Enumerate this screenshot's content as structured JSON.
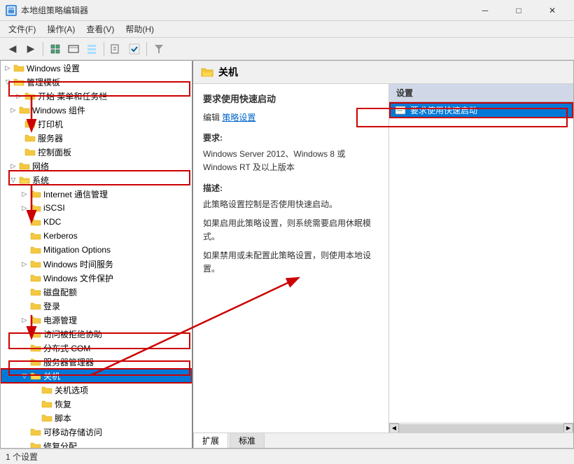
{
  "window": {
    "title": "本地组策略编辑器",
    "minimize": "─",
    "restore": "□",
    "close": "✕"
  },
  "menu": {
    "items": [
      "文件(F)",
      "操作(A)",
      "查看(V)",
      "帮助(H)"
    ]
  },
  "toolbar": {
    "buttons": [
      "◀",
      "▶",
      "⬆",
      "📋",
      "📋",
      "📋",
      "🔍",
      "🔍",
      "▼"
    ]
  },
  "tree": {
    "nodes": [
      {
        "id": "windows-settings",
        "label": "Windows 设置",
        "indent": 0,
        "expanded": false,
        "type": "folder"
      },
      {
        "id": "admin-templates",
        "label": "管理模板",
        "indent": 0,
        "expanded": true,
        "type": "folder-open",
        "highlighted": true
      },
      {
        "id": "start-menu",
        "label": "开始 菜单和任务栏",
        "indent": 2,
        "expanded": false,
        "type": "folder"
      },
      {
        "id": "windows-components",
        "label": "Windows 组件",
        "indent": 1,
        "expanded": false,
        "type": "folder"
      },
      {
        "id": "printers",
        "label": "打印机",
        "indent": 2,
        "expanded": false,
        "type": "folder"
      },
      {
        "id": "servers",
        "label": "服务器",
        "indent": 2,
        "expanded": false,
        "type": "folder"
      },
      {
        "id": "control-panel",
        "label": "控制面板",
        "indent": 2,
        "expanded": false,
        "type": "folder"
      },
      {
        "id": "network",
        "label": "网络",
        "indent": 1,
        "expanded": false,
        "type": "folder"
      },
      {
        "id": "system",
        "label": "系统",
        "indent": 1,
        "expanded": true,
        "type": "folder-open",
        "highlighted": true
      },
      {
        "id": "internet-mgmt",
        "label": "Internet 通信管理",
        "indent": 2,
        "expanded": false,
        "type": "folder"
      },
      {
        "id": "iscsi",
        "label": "iSCSI",
        "indent": 2,
        "expanded": false,
        "type": "folder"
      },
      {
        "id": "kdc",
        "label": "KDC",
        "indent": 2,
        "expanded": false,
        "type": "folder"
      },
      {
        "id": "kerberos",
        "label": "Kerberos",
        "indent": 2,
        "expanded": false,
        "type": "folder"
      },
      {
        "id": "mitigation-options",
        "label": "Mitigation Options",
        "indent": 2,
        "expanded": false,
        "type": "folder"
      },
      {
        "id": "windows-time",
        "label": "Windows 时间服务",
        "indent": 2,
        "expanded": false,
        "type": "folder"
      },
      {
        "id": "windows-file-protect",
        "label": "Windows 文件保护",
        "indent": 2,
        "expanded": false,
        "type": "folder"
      },
      {
        "id": "disk-quota",
        "label": "磁盘配额",
        "indent": 2,
        "expanded": false,
        "type": "folder"
      },
      {
        "id": "login",
        "label": "登录",
        "indent": 2,
        "expanded": false,
        "type": "folder"
      },
      {
        "id": "power-mgmt",
        "label": "电源管理",
        "indent": 2,
        "expanded": false,
        "type": "folder"
      },
      {
        "id": "access-denied",
        "label": "访问被拒绝协助",
        "indent": 2,
        "expanded": false,
        "type": "folder"
      },
      {
        "id": "distributed-com",
        "label": "分布式 COM",
        "indent": 2,
        "expanded": false,
        "type": "folder",
        "highlighted": true
      },
      {
        "id": "server-mgr",
        "label": "服务器管理器",
        "indent": 2,
        "expanded": false,
        "type": "folder"
      },
      {
        "id": "shutdown",
        "label": "关机",
        "indent": 2,
        "expanded": false,
        "type": "folder",
        "selected": true,
        "boxed": true
      },
      {
        "id": "shutdown-options",
        "label": "关机选项",
        "indent": 3,
        "expanded": false,
        "type": "folder"
      },
      {
        "id": "recovery",
        "label": "恢复",
        "indent": 3,
        "expanded": false,
        "type": "folder"
      },
      {
        "id": "script",
        "label": "脚本",
        "indent": 3,
        "expanded": false,
        "type": "folder"
      },
      {
        "id": "removable-storage",
        "label": "可移动存储访问",
        "indent": 2,
        "expanded": false,
        "type": "folder"
      },
      {
        "id": "more",
        "label": "修复分配",
        "indent": 2,
        "expanded": false,
        "type": "folder"
      }
    ]
  },
  "right_header": {
    "title": "关机",
    "icon": "folder"
  },
  "desc_panel": {
    "policy_name": "要求使用快速启动",
    "edit_label": "编辑",
    "policy_link": "策略设置",
    "requirements_title": "要求:",
    "requirements_text": "Windows Server 2012、Windows 8 或 Windows RT 及以上版本",
    "description_title": "描述:",
    "description_text": "此策略设置控制是否使用快速启动。",
    "note1": "如果启用此策略设置，则系统需要启用休眠模式。",
    "note2": "如果禁用或未配置此策略设置，则使用本地设置。"
  },
  "settings_panel": {
    "header": "设置",
    "items": [
      {
        "label": "要求使用快速启动",
        "selected": true
      }
    ]
  },
  "tabs": {
    "items": [
      "扩展",
      "标准"
    ],
    "active": "扩展"
  },
  "status_bar": {
    "text": "1 个设置"
  },
  "annotations": {
    "arrows": [
      {
        "id": "arrow1",
        "note": "admin-templates arrow"
      },
      {
        "id": "arrow2",
        "note": "system arrow"
      },
      {
        "id": "arrow3",
        "note": "distributed-com arrow"
      },
      {
        "id": "arrow4",
        "note": "shutdown arrow"
      }
    ]
  }
}
